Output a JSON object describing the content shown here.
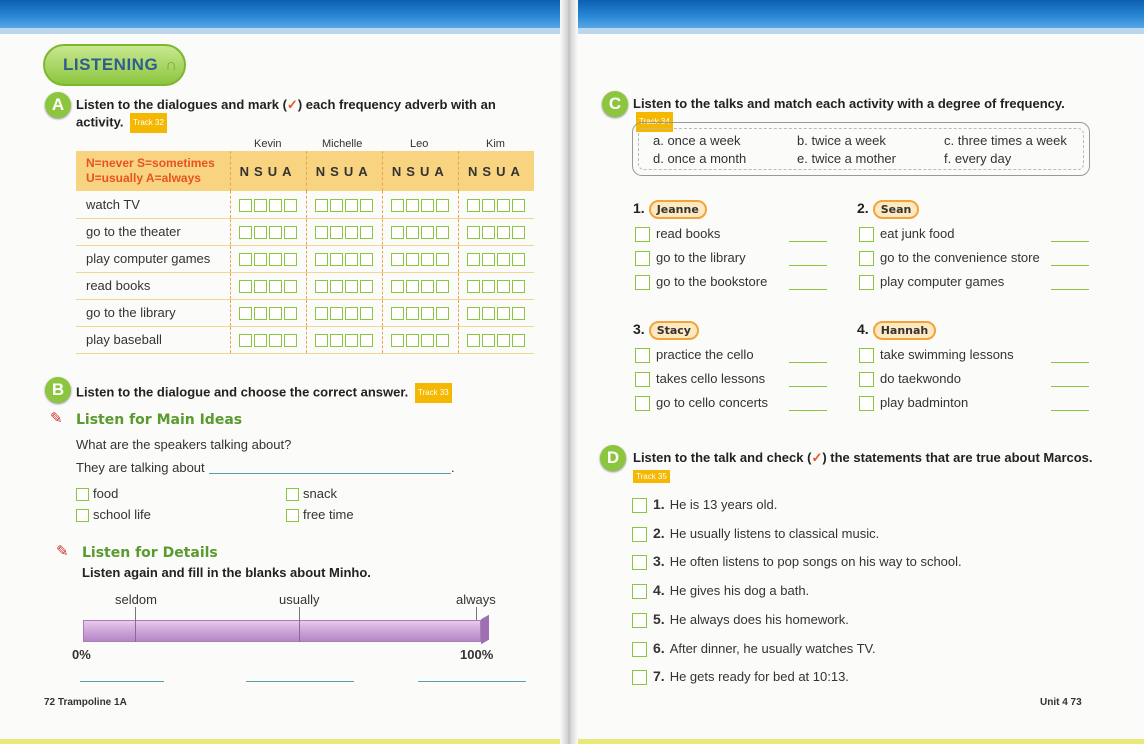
{
  "left": {
    "listening": "LISTENING",
    "sectionA": {
      "letter": "A",
      "instruction_1": "Listen to the dialogues and mark (",
      "check": "✓",
      "instruction_2": ") each frequency adverb with an",
      "instruction_3": "activity.",
      "track": "Track 32",
      "names": [
        "Kevin",
        "Michelle",
        "Leo",
        "Kim"
      ],
      "legend_1": "N=never   S=sometimes",
      "legend_2": "U=usually  A=always",
      "nsua": "NSUA",
      "activities": [
        "watch TV",
        "go to the theater",
        "play computer games",
        "read books",
        "go to the library",
        "play baseball"
      ]
    },
    "sectionB": {
      "letter": "B",
      "instruction": "Listen to the dialogue and choose the correct answer.",
      "track": "Track 33",
      "main_ideas": "Listen for Main Ideas",
      "question": "What are the speakers talking about?",
      "prompt": "They are talking about",
      "period": ".",
      "options": [
        "food",
        "snack",
        "school life",
        "free time"
      ],
      "details": "Listen for Details",
      "details_instr": "Listen again and fill in the blanks about Minho.",
      "scale_labels": [
        "seldom",
        "usually",
        "always"
      ],
      "scale_ends": [
        "0%",
        "100%"
      ]
    },
    "page_number": "72  Trampoline 1A"
  },
  "right": {
    "sectionC": {
      "letter": "C",
      "instruction": "Listen to the talks and match each activity with a degree of frequency.",
      "track": "Track 34",
      "options": [
        "a. once a week",
        "b. twice a week",
        "c. three times a week",
        "d. once a month",
        "e. twice a mother",
        "f. every day"
      ],
      "groups": [
        {
          "num": "1.",
          "name": "Jeanne",
          "items": [
            "read books",
            "go to the library",
            "go to the bookstore"
          ]
        },
        {
          "num": "2.",
          "name": "Sean",
          "items": [
            "eat junk food",
            "go to the convenience store",
            "play computer games"
          ]
        },
        {
          "num": "3.",
          "name": "Stacy",
          "items": [
            "practice the cello",
            "takes cello lessons",
            "go to cello concerts"
          ]
        },
        {
          "num": "4.",
          "name": "Hannah",
          "items": [
            "take swimming lessons",
            "do taekwondo",
            "play badminton"
          ]
        }
      ]
    },
    "sectionD": {
      "letter": "D",
      "instruction_1": "Listen to the talk and check (",
      "check": "✓",
      "instruction_2": ") the statements that are true about Marcos.",
      "track": "Track 35",
      "statements": [
        {
          "num": "1.",
          "text": "He is 13 years old."
        },
        {
          "num": "2.",
          "text": "He usually listens to classical music."
        },
        {
          "num": "3.",
          "text": "He often listens to pop songs on his way to school."
        },
        {
          "num": "4.",
          "text": "He gives his dog a bath."
        },
        {
          "num": "5.",
          "text": "He always does his homework."
        },
        {
          "num": "6.",
          "text": "After dinner, he usually watches TV."
        },
        {
          "num": "7.",
          "text": "He gets ready for bed at 10:13."
        }
      ]
    },
    "page_number": "Unit 4  73"
  }
}
